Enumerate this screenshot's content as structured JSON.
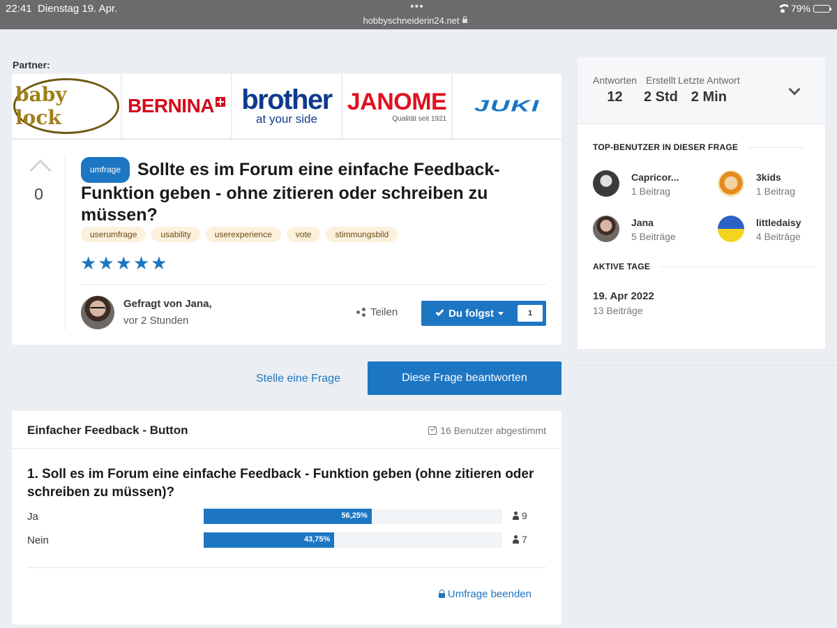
{
  "status": {
    "time": "22:41",
    "date": "Dienstag 19. Apr.",
    "url": "hobbyschneiderin24.net",
    "battery": "79%",
    "battery_level": 0.79
  },
  "partner": {
    "label": "Partner:",
    "logos": [
      "baby lock",
      "BERNINA",
      "brother",
      "at your side",
      "JANOME",
      "Qualität seit 1921",
      "JUKI"
    ]
  },
  "question": {
    "votes": "0",
    "badge": "umfrage",
    "title": "Sollte es im Forum eine einfache Feedback-Funktion geben - ohne zitieren oder schreiben zu müssen?",
    "tags": [
      "userumfrage",
      "usability",
      "userexperience",
      "vote",
      "stimmungsbild"
    ],
    "rating": 5,
    "asked_by": "Gefragt von Jana,",
    "asked_time": "vor 2 Stunden",
    "share": "Teilen",
    "follow": "Du folgst",
    "follow_count": "1"
  },
  "actions": {
    "ask": "Stelle eine Frage",
    "answer": "Diese Frage beantworten"
  },
  "poll": {
    "title": "Einfacher Feedback - Button",
    "voted": "16 Benutzer abgestimmt",
    "question": "1. Soll es im Forum eine einfache Feedback - Funktion geben (ohne zitieren oder schreiben zu müssen)?",
    "options": [
      {
        "label": "Ja",
        "percent": "56,25%",
        "fraction": 0.5625,
        "votes": "9"
      },
      {
        "label": "Nein",
        "percent": "43,75%",
        "fraction": 0.4375,
        "votes": "7"
      }
    ],
    "end": "Umfrage beenden"
  },
  "sidebar": {
    "stats": [
      {
        "label": "Antworten",
        "value": "12"
      },
      {
        "label": "Erstellt",
        "value": "2 Std"
      },
      {
        "label": "Letzte Antwort",
        "value": "2 Min"
      }
    ],
    "top_users_title": "TOP-BENUTZER IN DIESER FRAGE",
    "top_users": [
      {
        "name": "Capricor...",
        "count": "1 Beitrag"
      },
      {
        "name": "3kids",
        "count": "1 Beitrag"
      },
      {
        "name": "Jana",
        "count": "5 Beiträge"
      },
      {
        "name": "littledaisy",
        "count": "4 Beiträge"
      }
    ],
    "active_days_title": "AKTIVE TAGE",
    "active_day": {
      "date": "19. Apr 2022",
      "count": "13 Beiträge"
    }
  }
}
